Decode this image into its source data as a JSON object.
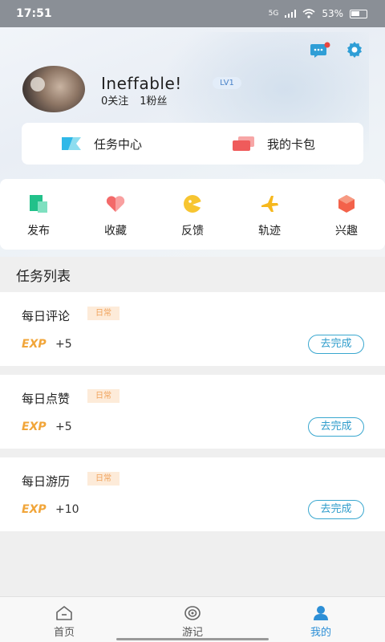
{
  "status": {
    "time": "17:51",
    "signal": "5G",
    "battery": "53%"
  },
  "profile": {
    "username": "Ineffable!",
    "level": "LV1",
    "following": "0关注",
    "followers": "1粉丝"
  },
  "top_card": {
    "task_center": "任务中心",
    "wallet": "我的卡包"
  },
  "quick_actions": [
    {
      "label": "发布",
      "icon": "publish-icon"
    },
    {
      "label": "收藏",
      "icon": "favorite-icon"
    },
    {
      "label": "反馈",
      "icon": "feedback-icon"
    },
    {
      "label": "轨迹",
      "icon": "track-icon"
    },
    {
      "label": "兴趣",
      "icon": "interest-icon"
    }
  ],
  "task_list": {
    "title": "任务列表",
    "tasks": [
      {
        "name": "每日评论",
        "tag": "日常",
        "exp_label": "EXP",
        "reward": "+5",
        "button": "去完成"
      },
      {
        "name": "每日点赞",
        "tag": "日常",
        "exp_label": "EXP",
        "reward": "+5",
        "button": "去完成"
      },
      {
        "name": "每日游历",
        "tag": "日常",
        "exp_label": "EXP",
        "reward": "+10",
        "button": "去完成"
      }
    ]
  },
  "bottom_nav": [
    {
      "label": "首页",
      "icon": "home-icon",
      "active": false
    },
    {
      "label": "游记",
      "icon": "travel-notes-icon",
      "active": false
    },
    {
      "label": "我的",
      "icon": "profile-icon",
      "active": true
    }
  ],
  "colors": {
    "accent": "#2d8fd6",
    "button_border": "#39a7cf",
    "exp": "#f1a539",
    "tag_bg": "#fdebd9",
    "tag_text": "#f0a25a"
  }
}
